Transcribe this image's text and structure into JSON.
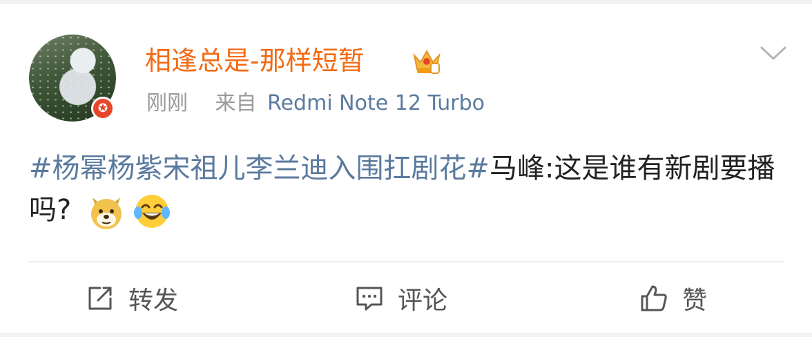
{
  "post": {
    "username": "相逢总是-那样短暂",
    "time": "刚刚",
    "source_prefix": "来自",
    "device": "Redmi Note 12 Turbo",
    "topic": "#杨幂杨紫宋祖儿李兰迪入围扛剧花#",
    "text": "马峰:这是谁有新剧要播吗?",
    "emojis": [
      "doge-emoji",
      "laugh-cry-emoji"
    ]
  },
  "actions": {
    "repost": "转发",
    "comment": "评论",
    "like": "赞"
  },
  "colors": {
    "username": "#f36a13",
    "link": "#5b7a9e",
    "meta": "#9a9a9a",
    "badge": "#e8462b"
  }
}
